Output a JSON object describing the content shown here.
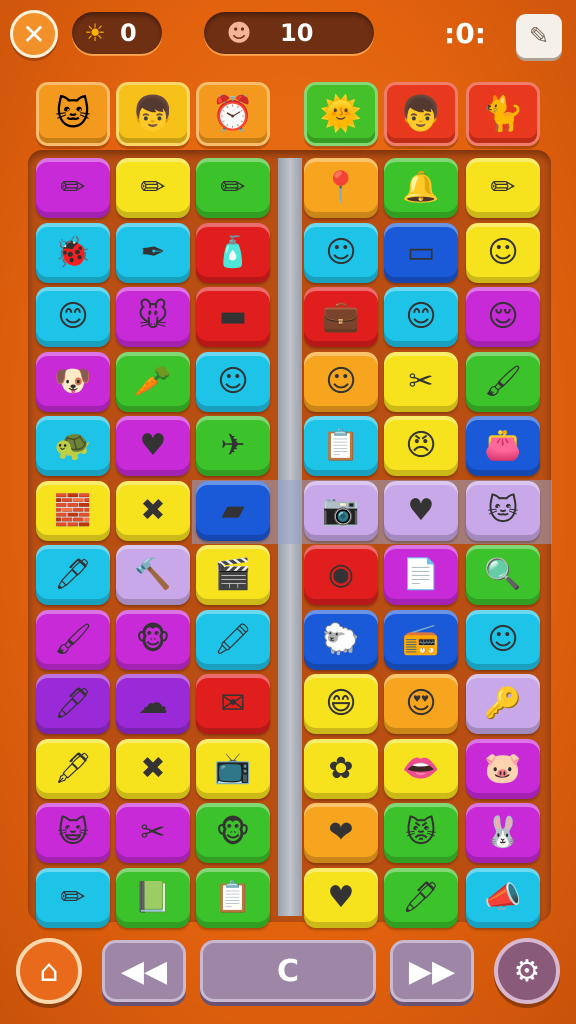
{
  "topbar": {
    "close_icon": "✕",
    "sun_icon": "☀",
    "sun_count": "0",
    "face_icon": "☻",
    "face_count": "10",
    "menu_glyph": ":0:",
    "edit_icon": "✎"
  },
  "avatars": [
    {
      "name": "cat-avatar",
      "icon": "🐱",
      "color": "#f39a1e"
    },
    {
      "name": "boy-avatar",
      "icon": "👦",
      "color": "#f6c21a"
    },
    {
      "name": "clock-avatar",
      "icon": "⏰",
      "color": "#f39a1e"
    },
    {
      "name": "sun-badge-avatar",
      "icon": "🌞",
      "color": "#44c02a"
    },
    {
      "name": "boy-red-avatar",
      "icon": "👦",
      "color": "#e8381e"
    },
    {
      "name": "cat-dark-avatar",
      "icon": "🐈",
      "color": "#e8381e"
    }
  ],
  "grid": {
    "rows": [
      [
        {
          "c": "#c82ad8",
          "i": "✏"
        },
        {
          "c": "#f7e21e",
          "i": "✏"
        },
        {
          "c": "#3cc22a",
          "i": "✏"
        },
        {
          "c": "#f7a41e",
          "i": "📍"
        },
        {
          "c": "#3cc22a",
          "i": "🔔"
        },
        {
          "c": "#f7e21e",
          "i": "✏"
        }
      ],
      [
        {
          "c": "#1ec4e8",
          "i": "🐞"
        },
        {
          "c": "#1ec4e8",
          "i": "✒"
        },
        {
          "c": "#e01e1e",
          "i": "🧴"
        },
        {
          "c": "#1ec4e8",
          "i": "☺"
        },
        {
          "c": "#1a5ad8",
          "i": "▭"
        },
        {
          "c": "#f7e21e",
          "i": "☺"
        }
      ],
      [
        {
          "c": "#1ec4e8",
          "i": "😊"
        },
        {
          "c": "#c82ad8",
          "i": "🐭"
        },
        {
          "c": "#e01e1e",
          "i": "▬"
        },
        {
          "c": "#e01e1e",
          "i": "💼"
        },
        {
          "c": "#1ec4e8",
          "i": "😊"
        },
        {
          "c": "#c82ad8",
          "i": "😌"
        }
      ],
      [
        {
          "c": "#c82ad8",
          "i": "🐶"
        },
        {
          "c": "#3cc22a",
          "i": "🥕"
        },
        {
          "c": "#1ec4e8",
          "i": "☺"
        },
        {
          "c": "#f7a41e",
          "i": "☺"
        },
        {
          "c": "#f7e21e",
          "i": "✂"
        },
        {
          "c": "#3cc22a",
          "i": "🖌"
        }
      ],
      [
        {
          "c": "#1ec4e8",
          "i": "🐢"
        },
        {
          "c": "#c82ad8",
          "i": "♥"
        },
        {
          "c": "#3cc22a",
          "i": "✈"
        },
        {
          "c": "#1ec4e8",
          "i": "📋"
        },
        {
          "c": "#f7e21e",
          "i": "😠"
        },
        {
          "c": "#1a5ad8",
          "i": "👛"
        }
      ],
      [
        {
          "c": "#f7e21e",
          "i": "🧱"
        },
        {
          "c": "#f7e21e",
          "i": "✖"
        },
        {
          "c": "#1a5ad8",
          "i": "▰"
        },
        {
          "c": "#c8a8e8",
          "i": "📷"
        },
        {
          "c": "#c8a8e8",
          "i": "♥"
        },
        {
          "c": "#c8a8e8",
          "i": "🐱"
        }
      ],
      [
        {
          "c": "#1ec4e8",
          "i": "🖊"
        },
        {
          "c": "#c8a8e8",
          "i": "🔨"
        },
        {
          "c": "#f7e21e",
          "i": "🎬"
        },
        {
          "c": "#e01e1e",
          "i": "◉"
        },
        {
          "c": "#c82ad8",
          "i": "📄"
        },
        {
          "c": "#3cc22a",
          "i": "🔍"
        }
      ],
      [
        {
          "c": "#c82ad8",
          "i": "🖌"
        },
        {
          "c": "#c82ad8",
          "i": "🐵"
        },
        {
          "c": "#1ec4e8",
          "i": "🖍"
        },
        {
          "c": "#1a5ad8",
          "i": "🐑"
        },
        {
          "c": "#1a5ad8",
          "i": "📻"
        },
        {
          "c": "#1ec4e8",
          "i": "☺"
        }
      ],
      [
        {
          "c": "#9a2ad8",
          "i": "🖊"
        },
        {
          "c": "#9a2ad8",
          "i": "☁"
        },
        {
          "c": "#e01e1e",
          "i": "✉"
        },
        {
          "c": "#f7e21e",
          "i": "😄"
        },
        {
          "c": "#f7a41e",
          "i": "😍"
        },
        {
          "c": "#c8a8e8",
          "i": "🔑"
        }
      ],
      [
        {
          "c": "#f7e21e",
          "i": "🖋"
        },
        {
          "c": "#f7e21e",
          "i": "✖"
        },
        {
          "c": "#f7e21e",
          "i": "📺"
        },
        {
          "c": "#f7e21e",
          "i": "✿"
        },
        {
          "c": "#f7e21e",
          "i": "👄"
        },
        {
          "c": "#c82ad8",
          "i": "🐷"
        }
      ],
      [
        {
          "c": "#c82ad8",
          "i": "😺"
        },
        {
          "c": "#c82ad8",
          "i": "✂"
        },
        {
          "c": "#3cc22a",
          "i": "🐵"
        },
        {
          "c": "#f7a41e",
          "i": "❤"
        },
        {
          "c": "#3cc22a",
          "i": "😾"
        },
        {
          "c": "#c82ad8",
          "i": "🐰"
        }
      ],
      [
        {
          "c": "#1ec4e8",
          "i": "✏"
        },
        {
          "c": "#3cc22a",
          "i": "📗"
        },
        {
          "c": "#3cc22a",
          "i": "📋"
        },
        {
          "c": "#f7e21e",
          "i": "♥"
        },
        {
          "c": "#3cc22a",
          "i": "🖊"
        },
        {
          "c": "#1ec4e8",
          "i": "📣"
        }
      ]
    ]
  },
  "bottombar": {
    "home_icon": "⌂",
    "prev_icon": "◀◀",
    "center_label": "C",
    "next_icon": "▶▶",
    "settings_icon": "⚙"
  }
}
